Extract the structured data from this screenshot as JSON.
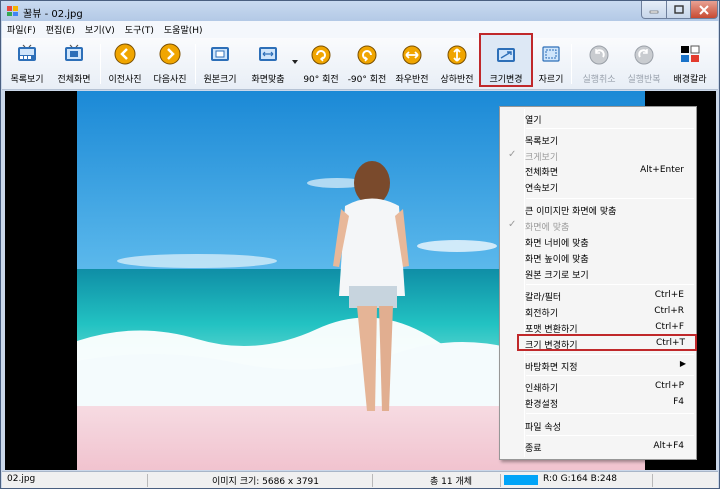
{
  "window": {
    "title": "꿀뷰 - 02.jpg"
  },
  "menubar": {
    "items": [
      "파일(F)",
      "편집(E)",
      "보기(V)",
      "도구(T)",
      "도움말(H)"
    ]
  },
  "toolbar": {
    "buttons": [
      {
        "label": "목록보기",
        "icon": "list-view-icon"
      },
      {
        "label": "전체화면",
        "icon": "fullscreen-icon"
      },
      {
        "label": "이전사진",
        "icon": "prev-arrow-icon"
      },
      {
        "label": "다음사진",
        "icon": "next-arrow-icon"
      },
      {
        "label": "원본크기",
        "icon": "original-size-icon"
      },
      {
        "label": "화면맞춤",
        "icon": "fit-screen-icon"
      },
      {
        "label": "90° 회전",
        "icon": "rotate-cw-icon"
      },
      {
        "label": "-90° 회전",
        "icon": "rotate-ccw-icon"
      },
      {
        "label": "좌우반전",
        "icon": "flip-horizontal-icon"
      },
      {
        "label": "상하반전",
        "icon": "flip-vertical-icon"
      },
      {
        "label": "크기변경",
        "icon": "resize-icon"
      },
      {
        "label": "자르기",
        "icon": "crop-icon"
      },
      {
        "label": "실행취소",
        "icon": "undo-icon"
      },
      {
        "label": "실행반복",
        "icon": "redo-icon"
      },
      {
        "label": "배경칼라",
        "icon": "background-color-icon"
      }
    ]
  },
  "context_menu": {
    "items": [
      {
        "label": "열기"
      },
      {
        "label": "목록보기"
      },
      {
        "label": "크게보기",
        "disabled": true,
        "checked": true
      },
      {
        "label": "전체화면",
        "shortcut": "Alt+Enter"
      },
      {
        "label": "연속보기"
      },
      {
        "label": "큰 이미지만 화면에 맞춤"
      },
      {
        "label": "화면에 맞춤",
        "disabled": true,
        "checked": true
      },
      {
        "label": "화면 너비에 맞춤"
      },
      {
        "label": "화면 높이에 맞춤"
      },
      {
        "label": "원본 크기로 보기"
      },
      {
        "label": "칼라/필터",
        "shortcut": "Ctrl+E"
      },
      {
        "label": "회전하기",
        "shortcut": "Ctrl+R"
      },
      {
        "label": "포맷 변환하기",
        "shortcut": "Ctrl+F"
      },
      {
        "label": "크기 변경하기",
        "shortcut": "Ctrl+T"
      },
      {
        "label": "바탕화면 지정",
        "submenu": true
      },
      {
        "label": "인쇄하기",
        "shortcut": "Ctrl+P"
      },
      {
        "label": "환경설정",
        "shortcut": "F4"
      },
      {
        "label": "파일 속성"
      },
      {
        "label": "종료",
        "shortcut": "Alt+F4"
      }
    ]
  },
  "statusbar": {
    "filename": "02.jpg",
    "image_size": "이미지 크기: 5686 x 3791",
    "count": "총 11 개체",
    "color_value": "R:0 G:164 B:248",
    "swatch_color": "#00a4f8"
  },
  "colors": {
    "highlight": "#c0282a"
  }
}
